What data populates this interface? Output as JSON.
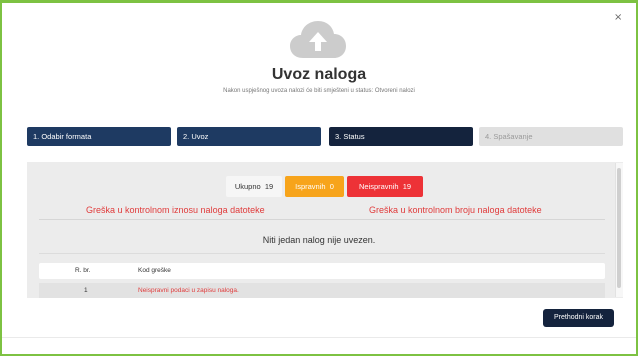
{
  "dialog": {
    "close_label": "×",
    "title": "Uvoz naloga",
    "subtitle": "Nakon uspješnog uvoza nalozi će biti smješteni u status: Otvoreni nalozi"
  },
  "steps": [
    {
      "label": "1. Odabir formata",
      "state": "done"
    },
    {
      "label": "2. Uvoz",
      "state": "done"
    },
    {
      "label": "3. Status",
      "state": "active"
    },
    {
      "label": "4. Spašavanje",
      "state": "disabled"
    }
  ],
  "summary": {
    "total_label": "Ukupno",
    "total_count": "19",
    "valid_label": "Ispravnih",
    "valid_count": "0",
    "invalid_label": "Neispravnih",
    "invalid_count": "19"
  },
  "errors": {
    "amount_error": "Greška u kontrolnom iznosu naloga datoteke",
    "count_error": "Greška u kontrolnom broju naloga datoteke"
  },
  "notice": "Niti jedan nalog nije uvezen.",
  "table": {
    "columns": [
      "R. br.",
      "Kod greške"
    ],
    "rows": [
      {
        "nr": "1",
        "kod": "Neispravni podaci u zapisu naloga."
      }
    ]
  },
  "buttons": {
    "previous": "Prethodni korak"
  },
  "colors": {
    "border": "#7dc242",
    "step_done": "#1e3a62",
    "step_active": "#14233d",
    "warning": "#f7a41b",
    "danger": "#ed3237"
  }
}
